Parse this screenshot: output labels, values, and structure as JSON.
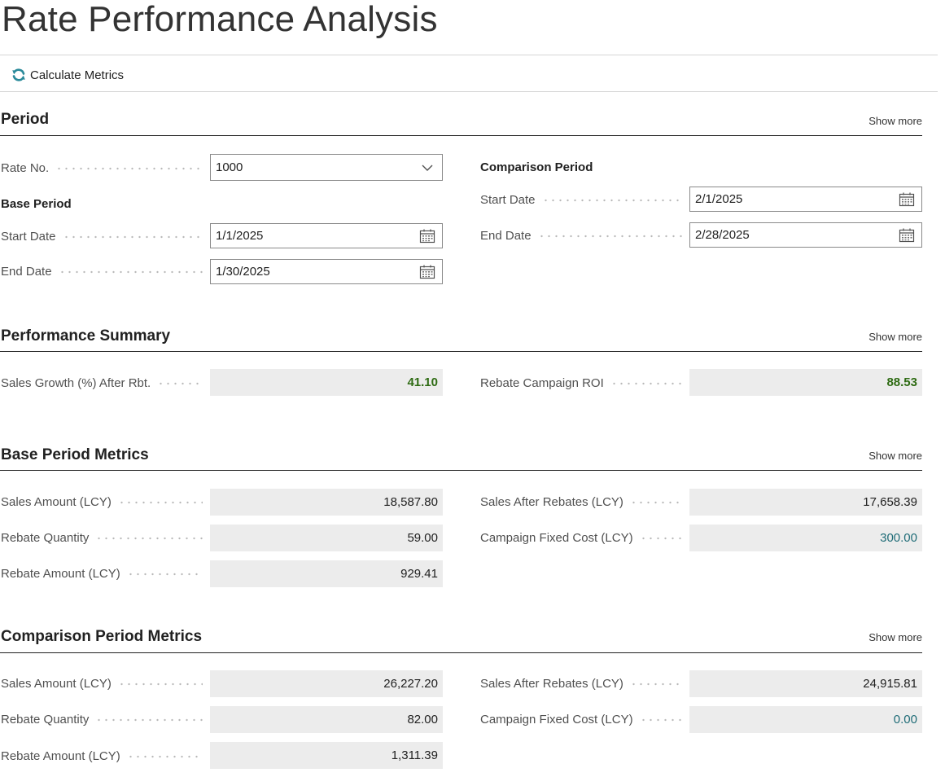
{
  "page": {
    "title": "Rate Performance Analysis"
  },
  "actions": {
    "calculate_label": "Calculate Metrics"
  },
  "sections": {
    "period": {
      "title": "Period",
      "show_more": "Show more",
      "rate_no_label": "Rate No.",
      "rate_no_value": "1000",
      "base_period": {
        "heading": "Base Period",
        "start_label": "Start Date",
        "start_value": "1/1/2025",
        "end_label": "End Date",
        "end_value": "1/30/2025"
      },
      "comparison_period": {
        "heading": "Comparison Period",
        "start_label": "Start Date",
        "start_value": "2/1/2025",
        "end_label": "End Date",
        "end_value": "2/28/2025"
      }
    },
    "summary": {
      "title": "Performance Summary",
      "show_more": "Show more",
      "sales_growth_label": "Sales Growth (%) After Rbt.",
      "sales_growth_value": "41.10",
      "roi_label": "Rebate Campaign ROI",
      "roi_value": "88.53"
    },
    "base_metrics": {
      "title": "Base Period Metrics",
      "show_more": "Show more",
      "sales_amount_label": "Sales Amount (LCY)",
      "sales_amount_value": "18,587.80",
      "rebate_qty_label": "Rebate Quantity",
      "rebate_qty_value": "59.00",
      "rebate_amount_label": "Rebate Amount (LCY)",
      "rebate_amount_value": "929.41",
      "sales_after_label": "Sales After Rebates (LCY)",
      "sales_after_value": "17,658.39",
      "fixed_cost_label": "Campaign Fixed Cost (LCY)",
      "fixed_cost_value": "300.00"
    },
    "comparison_metrics": {
      "title": "Comparison Period Metrics",
      "show_more": "Show more",
      "sales_amount_label": "Sales Amount (LCY)",
      "sales_amount_value": "26,227.20",
      "rebate_qty_label": "Rebate Quantity",
      "rebate_qty_value": "82.00",
      "rebate_amount_label": "Rebate Amount (LCY)",
      "rebate_amount_value": "1,311.39",
      "sales_after_label": "Sales After Rebates (LCY)",
      "sales_after_value": "24,915.81",
      "fixed_cost_label": "Campaign Fixed Cost (LCY)",
      "fixed_cost_value": "0.00"
    }
  },
  "icons": {
    "refresh": "refresh-icon",
    "calendar": "calendar-icon",
    "dropdown": "chevron-down-icon"
  },
  "colors": {
    "positive_value": "#2e6b13",
    "link_value": "#1f6c77",
    "refresh_icon": "#2a8a9a",
    "readonly_bg": "#ececec"
  }
}
